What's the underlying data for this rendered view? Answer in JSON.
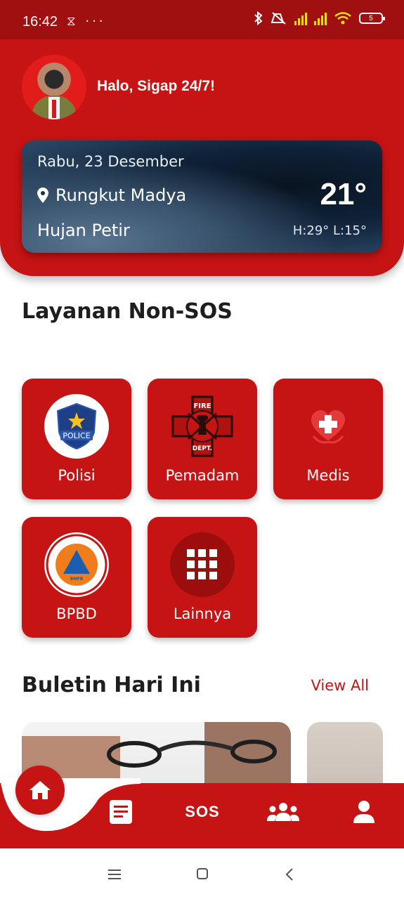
{
  "status_bar": {
    "time": "16:42",
    "left_icons": "⧖ ···",
    "battery": "5"
  },
  "header": {
    "greeting": "Halo, Sigap 24/7!"
  },
  "weather": {
    "date": "Rabu, 23 Desember",
    "location": "Rungkut Madya",
    "condition": "Hujan Petir",
    "temperature": "21°",
    "hi_lo": "H:29° L:15°"
  },
  "services": {
    "title": "Layanan Non-SOS",
    "items": [
      {
        "label": "Polisi",
        "icon": "police-badge-icon"
      },
      {
        "label": "Pemadam",
        "icon": "fire-dept-icon"
      },
      {
        "label": "Medis",
        "icon": "medical-cross-icon"
      },
      {
        "label": "BPBD",
        "icon": "bpbd-logo-icon",
        "logo_text": "BADAN NASIONAL PENANGGULANGAN BENCANA"
      },
      {
        "label": "Lainnya",
        "icon": "grid-icon"
      }
    ],
    "police_badge_text": "POLICE",
    "fire_badge_top": "FIRE",
    "fire_badge_bottom": "DEPT."
  },
  "bulletin": {
    "title": "Buletin Hari Ini",
    "view_all": "View All"
  },
  "bottom_nav": {
    "items": [
      "home-icon",
      "news-icon",
      "SOS",
      "community-icon",
      "profile-icon"
    ],
    "sos_label": "SOS"
  },
  "colors": {
    "primary": "#c61313",
    "status_bar": "#a11010",
    "text_dark": "#1e1e1e"
  }
}
